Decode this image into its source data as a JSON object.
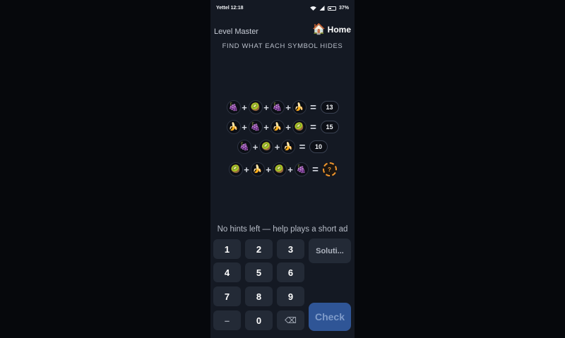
{
  "status_bar": {
    "carrier": "Yettel",
    "time": "12:18",
    "battery": "37%"
  },
  "header": {
    "level_title": "Level Master",
    "home_label": "Home",
    "home_icon": "house-icon"
  },
  "instruction": "FIND WHAT EACH SYMBOL HIDES",
  "symbols": {
    "grape": "🍇",
    "kiwi": "🥝",
    "banana": "🍌"
  },
  "equations": [
    {
      "terms": [
        "grape",
        "kiwi",
        "grape",
        "banana"
      ],
      "operator": "+",
      "equals": "=",
      "result": "13"
    },
    {
      "terms": [
        "banana",
        "grape",
        "banana",
        "kiwi"
      ],
      "operator": "+",
      "equals": "=",
      "result": "15"
    },
    {
      "terms": [
        "grape",
        "kiwi",
        "banana"
      ],
      "operator": "+",
      "equals": "=",
      "result": "10"
    },
    {
      "terms": [
        "kiwi",
        "banana",
        "kiwi",
        "grape"
      ],
      "operator": "+",
      "equals": "=",
      "result": "?"
    }
  ],
  "hint_text": "No hints left — help plays a short ad",
  "keypad": {
    "keys": [
      "1",
      "2",
      "3",
      "4",
      "5",
      "6",
      "7",
      "8",
      "9",
      "–",
      "0",
      "⌫"
    ],
    "solution_label": "Soluti...",
    "check_label": "Check"
  },
  "colors": {
    "background": "#141923",
    "key": "#232a36",
    "check": "#2f5596",
    "unknown_accent": "#f0962d"
  }
}
